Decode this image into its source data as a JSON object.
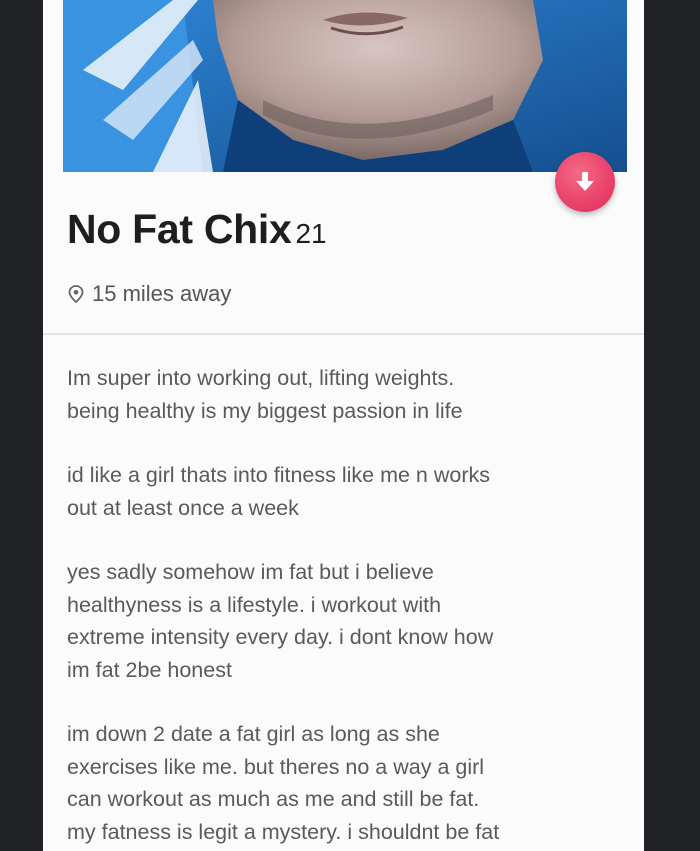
{
  "profile": {
    "name": "No Fat Chix",
    "age": "21",
    "distance": "15 miles away",
    "bio_paragraphs": [
      "Im super into working out, lifting weights.\nbeing healthy is my biggest passion in life",
      "id like a girl thats into fitness like me n works\nout at least once a week",
      "yes sadly somehow im fat but i believe\nhealthyness is a lifestyle. i workout with\nextreme intensity every day. i dont know how\nim fat 2be honest",
      "im down 2 date a fat girl as long as she\nexercises like me. but theres no a way a girl\ncan workout as much as me and still be fat.\nmy fatness is legit a mystery. i shouldnt be fat"
    ]
  },
  "icons": {
    "down_button": "arrow-down-icon",
    "location": "location-pin-icon"
  },
  "colors": {
    "accent": "#e9416a",
    "background": "#1f2124",
    "card": "#fbfbfb"
  }
}
